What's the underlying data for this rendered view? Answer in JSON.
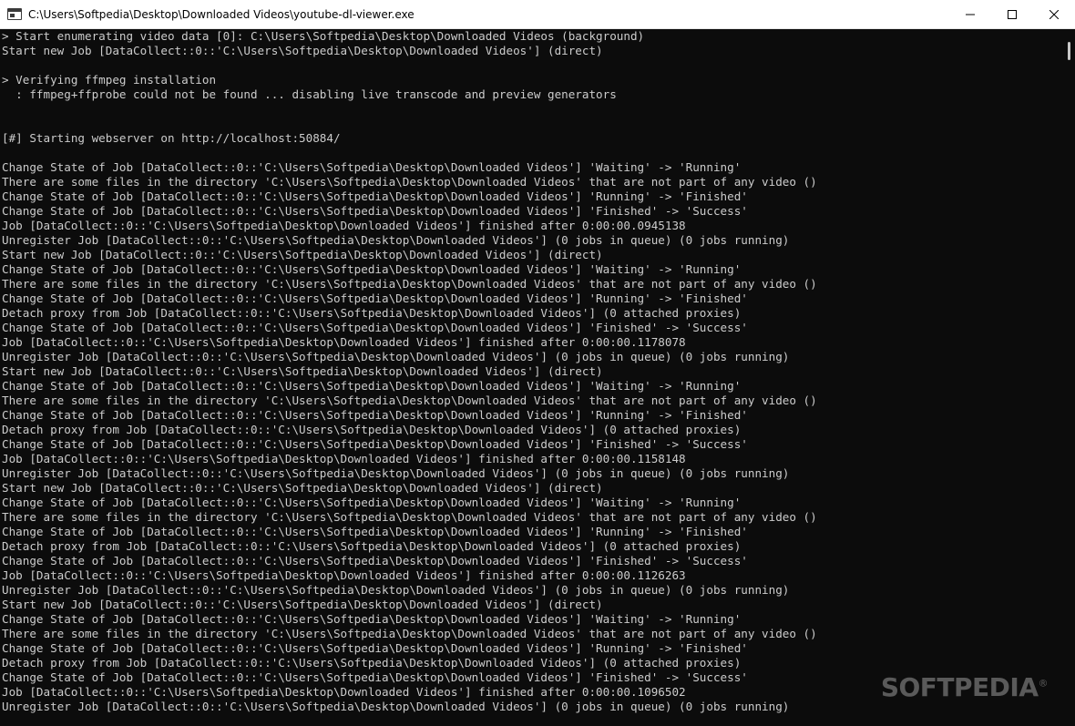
{
  "window": {
    "title": "C:\\Users\\Softpedia\\Desktop\\Downloaded Videos\\youtube-dl-viewer.exe",
    "icon": "console-icon"
  },
  "controls": {
    "minimize": "minimize-icon",
    "maximize": "maximize-icon",
    "close": "close-icon"
  },
  "colors": {
    "background": "#0c0c0c",
    "text": "#cccccc",
    "titlebar": "#ffffff"
  },
  "console": {
    "lines": [
      "> Start enumerating video data [0]: C:\\Users\\Softpedia\\Desktop\\Downloaded Videos (background)",
      "Start new Job [DataCollect::0::'C:\\Users\\Softpedia\\Desktop\\Downloaded Videos'] (direct)",
      "",
      "> Verifying ffmpeg installation",
      "  : ffmpeg+ffprobe could not be found ... disabling live transcode and preview generators",
      "",
      "",
      "[#] Starting webserver on http://localhost:50884/",
      "",
      "Change State of Job [DataCollect::0::'C:\\Users\\Softpedia\\Desktop\\Downloaded Videos'] 'Waiting' -> 'Running'",
      "There are some files in the directory 'C:\\Users\\Softpedia\\Desktop\\Downloaded Videos' that are not part of any video ()",
      "Change State of Job [DataCollect::0::'C:\\Users\\Softpedia\\Desktop\\Downloaded Videos'] 'Running' -> 'Finished'",
      "Change State of Job [DataCollect::0::'C:\\Users\\Softpedia\\Desktop\\Downloaded Videos'] 'Finished' -> 'Success'",
      "Job [DataCollect::0::'C:\\Users\\Softpedia\\Desktop\\Downloaded Videos'] finished after 0:00:00.0945138",
      "Unregister Job [DataCollect::0::'C:\\Users\\Softpedia\\Desktop\\Downloaded Videos'] (0 jobs in queue) (0 jobs running)",
      "Start new Job [DataCollect::0::'C:\\Users\\Softpedia\\Desktop\\Downloaded Videos'] (direct)",
      "Change State of Job [DataCollect::0::'C:\\Users\\Softpedia\\Desktop\\Downloaded Videos'] 'Waiting' -> 'Running'",
      "There are some files in the directory 'C:\\Users\\Softpedia\\Desktop\\Downloaded Videos' that are not part of any video ()",
      "Change State of Job [DataCollect::0::'C:\\Users\\Softpedia\\Desktop\\Downloaded Videos'] 'Running' -> 'Finished'",
      "Detach proxy from Job [DataCollect::0::'C:\\Users\\Softpedia\\Desktop\\Downloaded Videos'] (0 attached proxies)",
      "Change State of Job [DataCollect::0::'C:\\Users\\Softpedia\\Desktop\\Downloaded Videos'] 'Finished' -> 'Success'",
      "Job [DataCollect::0::'C:\\Users\\Softpedia\\Desktop\\Downloaded Videos'] finished after 0:00:00.1178078",
      "Unregister Job [DataCollect::0::'C:\\Users\\Softpedia\\Desktop\\Downloaded Videos'] (0 jobs in queue) (0 jobs running)",
      "Start new Job [DataCollect::0::'C:\\Users\\Softpedia\\Desktop\\Downloaded Videos'] (direct)",
      "Change State of Job [DataCollect::0::'C:\\Users\\Softpedia\\Desktop\\Downloaded Videos'] 'Waiting' -> 'Running'",
      "There are some files in the directory 'C:\\Users\\Softpedia\\Desktop\\Downloaded Videos' that are not part of any video ()",
      "Change State of Job [DataCollect::0::'C:\\Users\\Softpedia\\Desktop\\Downloaded Videos'] 'Running' -> 'Finished'",
      "Detach proxy from Job [DataCollect::0::'C:\\Users\\Softpedia\\Desktop\\Downloaded Videos'] (0 attached proxies)",
      "Change State of Job [DataCollect::0::'C:\\Users\\Softpedia\\Desktop\\Downloaded Videos'] 'Finished' -> 'Success'",
      "Job [DataCollect::0::'C:\\Users\\Softpedia\\Desktop\\Downloaded Videos'] finished after 0:00:00.1158148",
      "Unregister Job [DataCollect::0::'C:\\Users\\Softpedia\\Desktop\\Downloaded Videos'] (0 jobs in queue) (0 jobs running)",
      "Start new Job [DataCollect::0::'C:\\Users\\Softpedia\\Desktop\\Downloaded Videos'] (direct)",
      "Change State of Job [DataCollect::0::'C:\\Users\\Softpedia\\Desktop\\Downloaded Videos'] 'Waiting' -> 'Running'",
      "There are some files in the directory 'C:\\Users\\Softpedia\\Desktop\\Downloaded Videos' that are not part of any video ()",
      "Change State of Job [DataCollect::0::'C:\\Users\\Softpedia\\Desktop\\Downloaded Videos'] 'Running' -> 'Finished'",
      "Detach proxy from Job [DataCollect::0::'C:\\Users\\Softpedia\\Desktop\\Downloaded Videos'] (0 attached proxies)",
      "Change State of Job [DataCollect::0::'C:\\Users\\Softpedia\\Desktop\\Downloaded Videos'] 'Finished' -> 'Success'",
      "Job [DataCollect::0::'C:\\Users\\Softpedia\\Desktop\\Downloaded Videos'] finished after 0:00:00.1126263",
      "Unregister Job [DataCollect::0::'C:\\Users\\Softpedia\\Desktop\\Downloaded Videos'] (0 jobs in queue) (0 jobs running)",
      "Start new Job [DataCollect::0::'C:\\Users\\Softpedia\\Desktop\\Downloaded Videos'] (direct)",
      "Change State of Job [DataCollect::0::'C:\\Users\\Softpedia\\Desktop\\Downloaded Videos'] 'Waiting' -> 'Running'",
      "There are some files in the directory 'C:\\Users\\Softpedia\\Desktop\\Downloaded Videos' that are not part of any video ()",
      "Change State of Job [DataCollect::0::'C:\\Users\\Softpedia\\Desktop\\Downloaded Videos'] 'Running' -> 'Finished'",
      "Detach proxy from Job [DataCollect::0::'C:\\Users\\Softpedia\\Desktop\\Downloaded Videos'] (0 attached proxies)",
      "Change State of Job [DataCollect::0::'C:\\Users\\Softpedia\\Desktop\\Downloaded Videos'] 'Finished' -> 'Success'",
      "Job [DataCollect::0::'C:\\Users\\Softpedia\\Desktop\\Downloaded Videos'] finished after 0:00:00.1096502",
      "Unregister Job [DataCollect::0::'C:\\Users\\Softpedia\\Desktop\\Downloaded Videos'] (0 jobs in queue) (0 jobs running)"
    ]
  },
  "watermark": {
    "text": "SOFTPEDIA",
    "mark": "®"
  }
}
